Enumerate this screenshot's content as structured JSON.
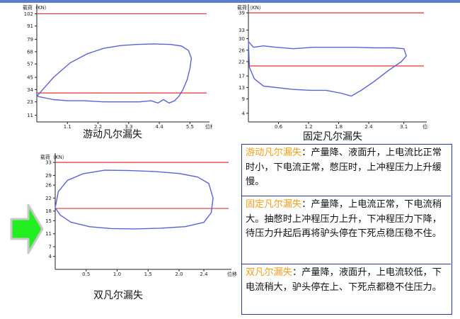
{
  "chart_data": [
    {
      "type": "line",
      "ylabel": "载荷（KN）",
      "xlabel": "位移",
      "caption": "游动凡尔漏失",
      "y_ticks": [
        "102",
        "91",
        "79",
        "68",
        "57",
        "45",
        "34",
        "23",
        "11"
      ],
      "y_tick_values": [
        102,
        91,
        79,
        68,
        57,
        45,
        34,
        23,
        11
      ],
      "x_ticks": [
        "1.1",
        "2.2",
        "3.3",
        "4.4",
        "5.5"
      ],
      "x_tick_values": [
        1.1,
        2.2,
        3.3,
        4.4,
        5.5
      ],
      "xlim": [
        0,
        6.1
      ],
      "ylim": [
        5,
        108
      ],
      "ref_lines": [
        102,
        31
      ],
      "line_color": "#5a62d8",
      "ref_color": "#e33434",
      "series": [
        {
          "x": [
            0,
            0.6,
            1.2,
            1.8,
            2.4,
            3,
            3.6,
            4.2,
            4.8,
            5.2,
            5.45,
            5.55,
            5.5,
            5.4,
            5.25,
            5.1,
            4.95,
            4.75,
            4.55,
            4.35,
            4.1,
            3.7,
            3.1,
            2.4,
            1.7,
            1.1,
            0.6,
            0
          ],
          "y": [
            28,
            45,
            58,
            66,
            71,
            73.5,
            74.5,
            75,
            74.5,
            73,
            69,
            62,
            53,
            43,
            34,
            28,
            24,
            22,
            25,
            22,
            24,
            23,
            23,
            23,
            24,
            24,
            25,
            28
          ]
        }
      ]
    },
    {
      "type": "line",
      "ylabel": "载荷（KN）",
      "xlabel": "位移",
      "caption": "固定凡尔漏失",
      "y_ticks": [
        "39",
        "33",
        "30",
        "26",
        "22",
        "17",
        "13",
        "9",
        "4"
      ],
      "y_tick_values": [
        39,
        33,
        30,
        26,
        22,
        17,
        13,
        9,
        4
      ],
      "x_ticks": [
        "0.6",
        "1.2",
        "1.8",
        "2.4",
        "3.1"
      ],
      "x_tick_values": [
        0.6,
        1.2,
        1.8,
        2.4,
        3.1
      ],
      "xlim": [
        0,
        3.5
      ],
      "ylim": [
        1,
        41
      ],
      "ref_lines": [
        39,
        20.5
      ],
      "line_color": "#5a62d8",
      "ref_color": "#e33434",
      "series": [
        {
          "x": [
            0,
            0.1,
            0.3,
            0.55,
            0.9,
            1.3,
            1.7,
            2.1,
            2.5,
            2.9,
            3.1,
            3.15,
            3.05,
            2.8,
            2.5,
            2.25,
            2.05,
            1.85,
            1.55,
            1.25,
            0.9,
            0.55,
            0.3,
            0.12,
            0.02,
            0
          ],
          "y": [
            29,
            27,
            27.5,
            27,
            26.5,
            27,
            27,
            27,
            26.8,
            26.8,
            26.5,
            24,
            22,
            19,
            15,
            12,
            10,
            11,
            12,
            12,
            12.3,
            13,
            13.5,
            16,
            20,
            29
          ]
        }
      ]
    },
    {
      "type": "line",
      "ylabel": "载荷（KN）",
      "xlabel": "位移",
      "caption": "双凡尔漏失",
      "y_ticks": [
        "33",
        "29",
        "26",
        "22",
        "18",
        "15",
        "11",
        "7",
        "4"
      ],
      "y_tick_values": [
        33,
        29,
        26,
        22,
        18,
        15,
        11,
        7,
        4
      ],
      "x_ticks": [
        "0.5",
        "1.0",
        "1.5",
        "2.0",
        "2.4"
      ],
      "x_tick_values": [
        0.5,
        1.0,
        1.5,
        2.0,
        2.4
      ],
      "xlim": [
        0,
        2.8
      ],
      "ylim": [
        0,
        35
      ],
      "ref_lines": [
        33,
        18.8
      ],
      "line_color": "#5a62d8",
      "ref_color": "#e33434",
      "series": [
        {
          "x": [
            0,
            0.05,
            0.2,
            0.45,
            0.8,
            1.2,
            1.6,
            2.0,
            2.3,
            2.48,
            2.55,
            2.52,
            2.4,
            2.1,
            1.7,
            1.3,
            0.9,
            0.55,
            0.25,
            0.08,
            0
          ],
          "y": [
            19,
            24,
            27.5,
            29.5,
            30.6,
            30.5,
            30.2,
            29.6,
            28.5,
            26.5,
            22,
            17.5,
            14.5,
            13.2,
            12.7,
            12.5,
            12.6,
            13.2,
            14.6,
            16.8,
            19
          ]
        }
      ]
    }
  ],
  "info": [
    {
      "title": "游动凡尔漏失",
      "sep": "：",
      "body": "产量降、液面升，上电流比正常时小，下电流正常，憋压时，上冲程压力上升缓慢。"
    },
    {
      "title": "固定凡尔漏失",
      "sep": "：",
      "body": "产量降，上电流正常，下电流稍大。抽憋时上冲程压力上升，下冲程压力下降，待压力升起后再将驴头停在下死点稳压稳不住。"
    },
    {
      "title": "双凡尔漏失",
      "sep": "：",
      "body": "产量降，液面升，上电流较低，下电流稍大，驴头停在上、下死点都稳不住压力。"
    }
  ]
}
